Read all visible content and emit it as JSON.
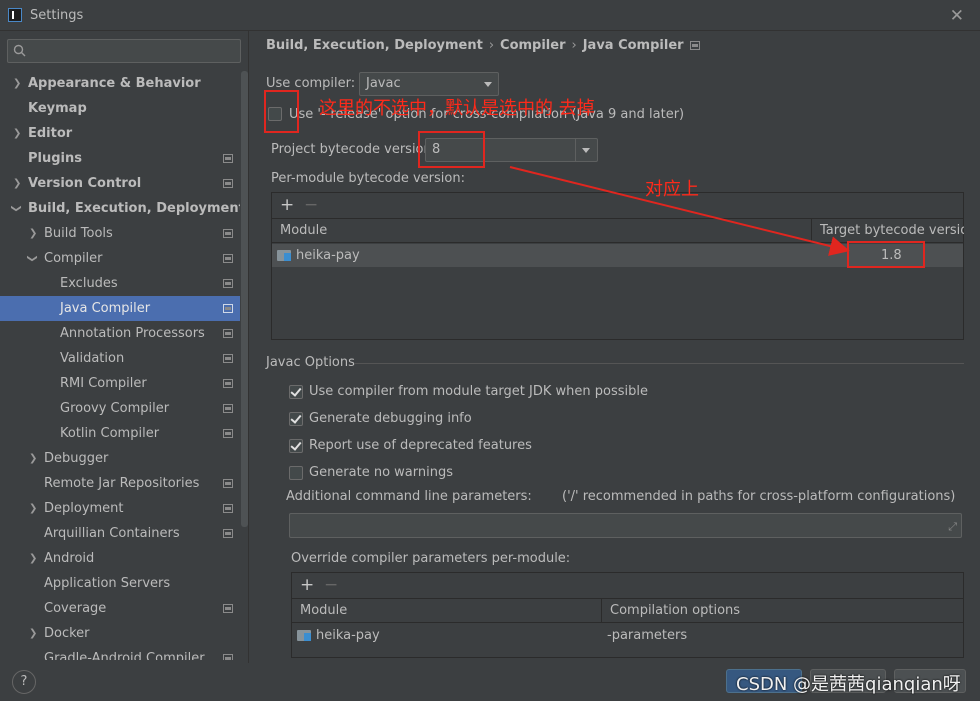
{
  "window": {
    "title": "Settings"
  },
  "search": {
    "placeholder": ""
  },
  "sidebar": {
    "items": [
      {
        "label": "Appearance & Behavior"
      },
      {
        "label": "Keymap"
      },
      {
        "label": "Editor"
      },
      {
        "label": "Plugins"
      },
      {
        "label": "Version Control"
      },
      {
        "label": "Build, Execution, Deployment"
      },
      {
        "label": "Build Tools"
      },
      {
        "label": "Compiler"
      },
      {
        "label": "Excludes"
      },
      {
        "label": "Java Compiler"
      },
      {
        "label": "Annotation Processors"
      },
      {
        "label": "Validation"
      },
      {
        "label": "RMI Compiler"
      },
      {
        "label": "Groovy Compiler"
      },
      {
        "label": "Kotlin Compiler"
      },
      {
        "label": "Debugger"
      },
      {
        "label": "Remote Jar Repositories"
      },
      {
        "label": "Deployment"
      },
      {
        "label": "Arquillian Containers"
      },
      {
        "label": "Android"
      },
      {
        "label": "Application Servers"
      },
      {
        "label": "Coverage"
      },
      {
        "label": "Docker"
      },
      {
        "label": "Gradle-Android Compiler"
      }
    ]
  },
  "breadcrumb": {
    "part1": "Build, Execution, Deployment",
    "part2": "Compiler",
    "part3": "Java Compiler"
  },
  "compiler": {
    "use_compiler_label": "Use compiler:",
    "use_compiler_value": "Javac",
    "release_option_label": "Use '--release' option for cross-compilation (Java 9 and later)",
    "project_bytecode_label": "Project bytecode version",
    "project_bytecode_value": "8",
    "per_module_label": "Per-module bytecode version:",
    "module_col": "Module",
    "target_col": "Target bytecode version",
    "module_name": "heika-pay",
    "target_value": "1.8"
  },
  "javac": {
    "section_title": "Javac Options",
    "opt1": "Use compiler from module target JDK when possible",
    "opt2": "Generate debugging info",
    "opt3": "Report use of deprecated features",
    "opt4": "Generate no warnings",
    "additional_label": "Additional command line parameters:",
    "additional_hint": "('/' recommended in paths for cross-platform configurations)",
    "additional_value": "",
    "override_label": "Override compiler parameters per-module:",
    "override_module_col": "Module",
    "override_options_col": "Compilation options",
    "override_module": "heika-pay",
    "override_options": "-parameters"
  },
  "annotations": {
    "note1": "这里的不选中，默认是选中的 去掉",
    "note2": "对应上",
    "color": "#e0261f"
  },
  "footer": {
    "help": "?",
    "watermark": "CSDN @是茜茜qianqian呀"
  }
}
